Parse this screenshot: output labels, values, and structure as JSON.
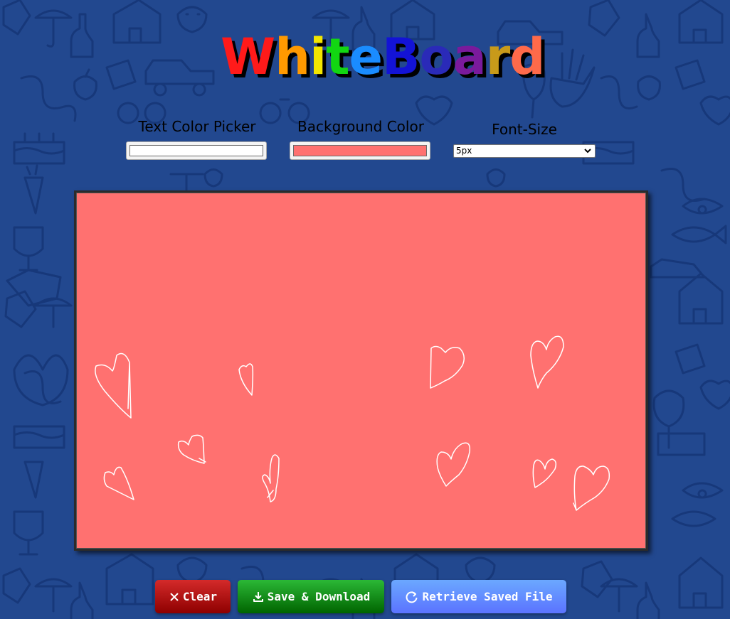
{
  "app": {
    "title_letters": [
      {
        "char": "W",
        "color": "#ff1a1a"
      },
      {
        "char": "h",
        "color": "#ff9900"
      },
      {
        "char": "i",
        "color": "#f2e600"
      },
      {
        "char": "t",
        "color": "#12d612"
      },
      {
        "char": "e",
        "color": "#1a8cff"
      },
      {
        "char": "B",
        "color": "#1313d6"
      },
      {
        "char": "o",
        "color": "#2a2ab8"
      },
      {
        "char": "a",
        "color": "#7a1a9c"
      },
      {
        "char": "r",
        "color": "#c89a1a"
      },
      {
        "char": "d",
        "color": "#ff6a4a"
      }
    ]
  },
  "controls": {
    "text_color": {
      "label": "Text Color Picker",
      "value": "#ffffff"
    },
    "background_color": {
      "label": "Background Color",
      "value": "#ff7170"
    },
    "font_size": {
      "label": "Font-Size",
      "selected": "5px"
    }
  },
  "canvas": {
    "background": "#ff7170",
    "stroke_color": "#ffffff",
    "drawing_description": "hand-drawn hearts"
  },
  "buttons": {
    "clear": {
      "label": "Clear",
      "icon": "x-icon",
      "color": "#b01515"
    },
    "save": {
      "label": "Save & Download",
      "icon": "download-icon",
      "color": "#119a1d"
    },
    "retrieve": {
      "label": "Retrieve Saved File",
      "icon": "refresh-icon",
      "color": "#6a8eff"
    }
  },
  "background_pattern": {
    "color": "#22488f",
    "icons": [
      "house-icon",
      "bottle-icon",
      "umbrella-icon",
      "gem-icon",
      "car-icon",
      "hand-icon",
      "apple-icon",
      "heart-icon",
      "cake-icon",
      "carrot-icon",
      "trophy-icon",
      "eye-icon",
      "fish-icon",
      "tree-icon",
      "skull-icon"
    ]
  }
}
